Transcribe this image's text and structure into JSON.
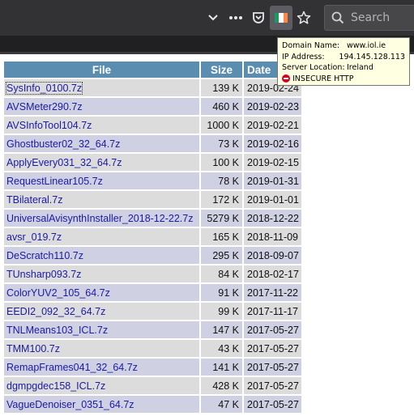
{
  "toolbar": {
    "search_placeholder": "Search",
    "icons": [
      "chevron-down-icon",
      "more-dots-icon",
      "pocket-icon",
      "ireland-flag-icon",
      "star-icon",
      "search-icon"
    ],
    "flag_colors": [
      "#169b62",
      "#ffffff",
      "#ff883e"
    ]
  },
  "tooltip": {
    "domain_label": "Domain Name:",
    "domain_value": "www.iol.ie",
    "ip_label": "IP Address:",
    "ip_value": "194.145.128.113",
    "location_label": "Server Location:",
    "location_value": "Ireland",
    "insecure_label": "INSECURE HTTP"
  },
  "table": {
    "headers": {
      "file": "File",
      "size": "Size",
      "date": "Date"
    },
    "rows": [
      {
        "file": "SysInfo_0100.7z",
        "size": "139 K",
        "date": "2019-02-24"
      },
      {
        "file": "AVSMeter290.7z",
        "size": "460 K",
        "date": "2019-02-23"
      },
      {
        "file": "AVSInfoTool104.7z",
        "size": "1000 K",
        "date": "2019-02-21"
      },
      {
        "file": "Ghostbuster02_32_64.7z",
        "size": "73 K",
        "date": "2019-02-16"
      },
      {
        "file": "ApplyEvery031_32_64.7z",
        "size": "100 K",
        "date": "2019-02-15"
      },
      {
        "file": "RequestLinear105.7z",
        "size": "78 K",
        "date": "2019-01-31"
      },
      {
        "file": "TBilateral.7z",
        "size": "172 K",
        "date": "2019-01-01"
      },
      {
        "file": "UniversalAvisynthInstaller_2018-12-22.7z",
        "size": "5279 K",
        "date": "2018-12-22"
      },
      {
        "file": "avsr_019.7z",
        "size": "165 K",
        "date": "2018-11-09"
      },
      {
        "file": "DeScratch110.7z",
        "size": "295 K",
        "date": "2018-09-07"
      },
      {
        "file": "TUnsharp093.7z",
        "size": "84 K",
        "date": "2018-02-17"
      },
      {
        "file": "ColorYUV2_105_64.7z",
        "size": "91 K",
        "date": "2017-11-22"
      },
      {
        "file": "EEDI2_092_32_64.7z",
        "size": "99 K",
        "date": "2017-11-17"
      },
      {
        "file": "TNLMeans103_ICL.7z",
        "size": "147 K",
        "date": "2017-05-27"
      },
      {
        "file": "TMM100.7z",
        "size": "43 K",
        "date": "2017-05-27"
      },
      {
        "file": "RemapFrames041_32_64.7z",
        "size": "141 K",
        "date": "2017-05-27"
      },
      {
        "file": "dgmpgdec158_ICL.7z",
        "size": "428 K",
        "date": "2017-05-27"
      },
      {
        "file": "VagueDenoiser_0351_64.7z",
        "size": "47 K",
        "date": "2017-05-27"
      }
    ]
  }
}
